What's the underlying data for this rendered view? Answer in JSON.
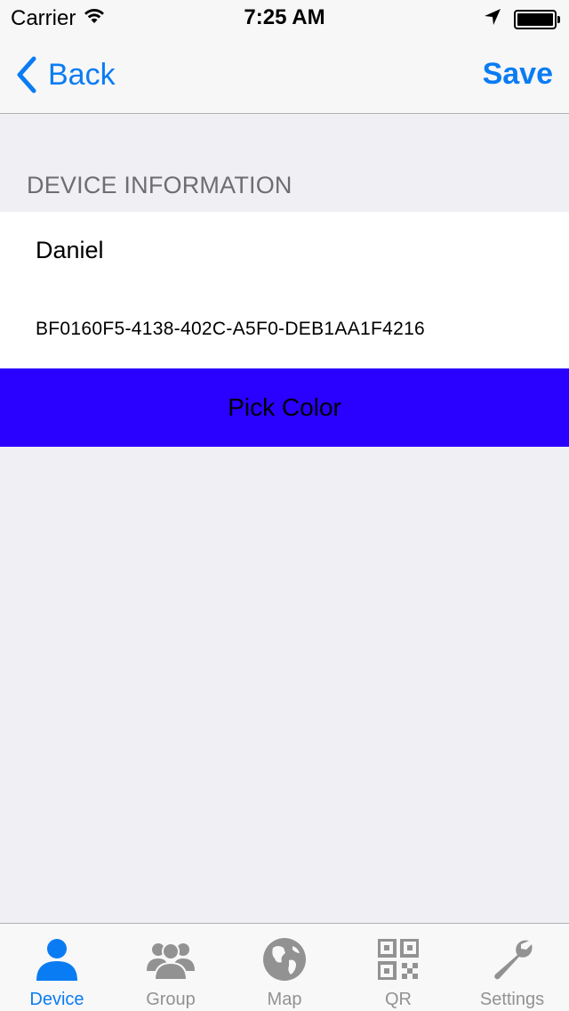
{
  "status_bar": {
    "carrier": "Carrier",
    "time": "7:25 AM",
    "icons": [
      "wifi-icon",
      "location-arrow-icon",
      "battery-icon"
    ]
  },
  "nav_bar": {
    "back_label": "Back",
    "save_label": "Save"
  },
  "section": {
    "header": "DEVICE INFORMATION",
    "device_name": "Daniel",
    "device_uuid": "BF0160F5-4138-402C-A5F0-DEB1AA1F4216"
  },
  "pick_color": {
    "label": "Pick Color",
    "background": "#2a00ff"
  },
  "tab_bar": {
    "active_color": "#0a7cf3",
    "inactive_color": "#929292",
    "items": [
      {
        "label": "Device",
        "icon": "person-icon",
        "active": true
      },
      {
        "label": "Group",
        "icon": "group-icon",
        "active": false
      },
      {
        "label": "Map",
        "icon": "globe-icon",
        "active": false
      },
      {
        "label": "QR",
        "icon": "qr-code-icon",
        "active": false
      },
      {
        "label": "Settings",
        "icon": "wrench-icon",
        "active": false
      }
    ]
  }
}
